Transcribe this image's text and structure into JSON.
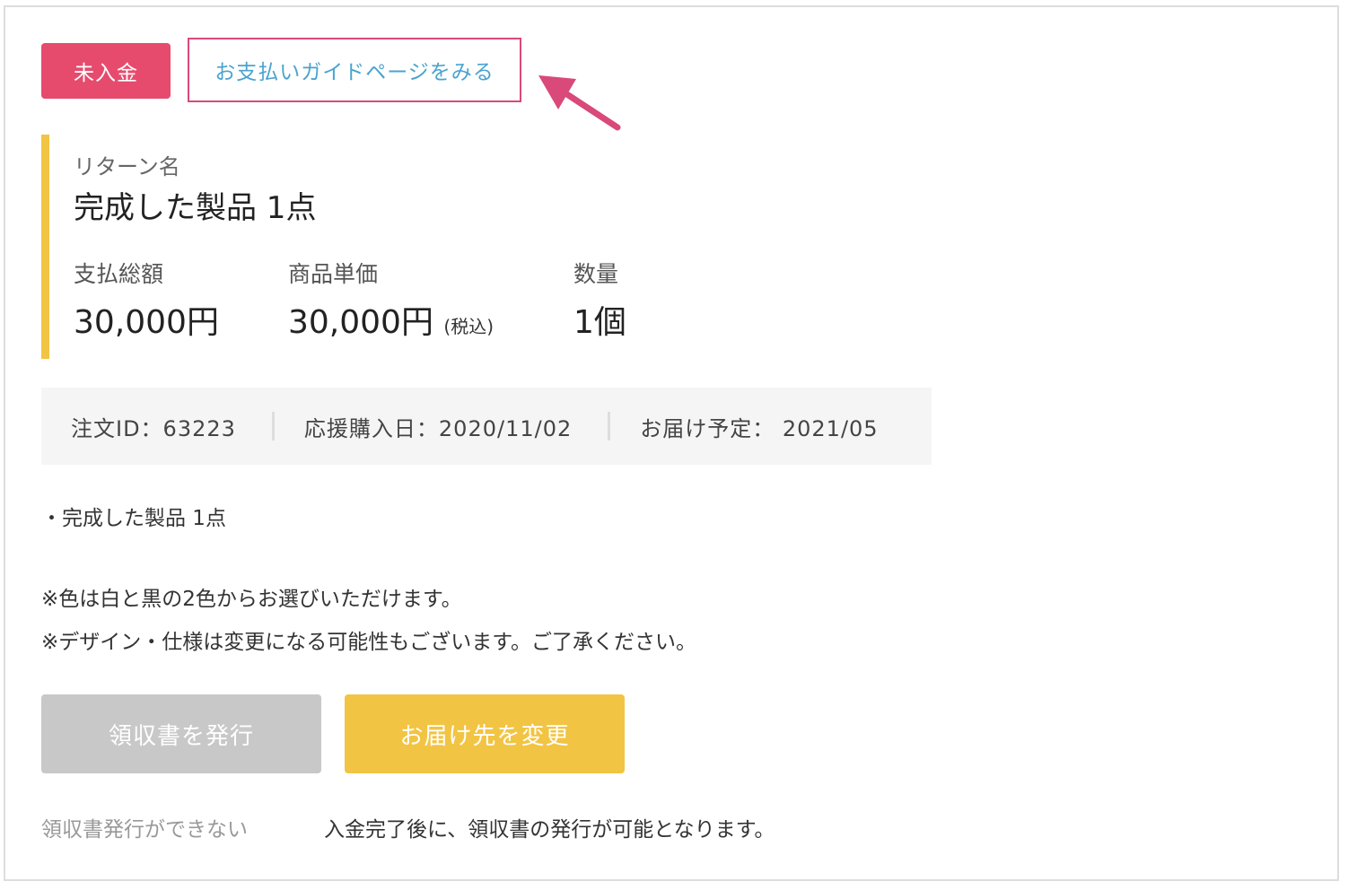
{
  "status_badge": "未入金",
  "guide_link": "お支払いガイドページをみる",
  "accent_colors": {
    "badge": "#e64b6e",
    "highlight_border": "#d9497a",
    "link": "#4aa3cf",
    "reward_bar": "#f2c443",
    "change_button": "#f2c443",
    "disabled_button": "#c8c8c8"
  },
  "reward": {
    "label": "リターン名",
    "name": "完成した製品 1点"
  },
  "metrics": {
    "total": {
      "label": "支払総額",
      "value": "30,000円"
    },
    "unit_price": {
      "label": "商品単価",
      "value": "30,000円",
      "note": "(税込)"
    },
    "quantity": {
      "label": "数量",
      "value": "1個"
    }
  },
  "order_info": {
    "order_id": "注文ID：63223",
    "purchase_date": "応援購入日：2020/11/02",
    "delivery": "お届け予定： 2021/05"
  },
  "description": {
    "item": "・完成した製品 1点",
    "note1": "※色は白と黒の2色からお選びいただけます。",
    "note2": "※デザイン・仕様は変更になる可能性もございます。ご了承ください。"
  },
  "buttons": {
    "receipt": "領収書を発行",
    "change_address": "お届け先を変更"
  },
  "receipt": {
    "status": "領収書発行ができない",
    "note": "入金完了後に、領収書の発行が可能となります。"
  },
  "icons": {
    "annotation": "arrow-pointer-icon"
  }
}
